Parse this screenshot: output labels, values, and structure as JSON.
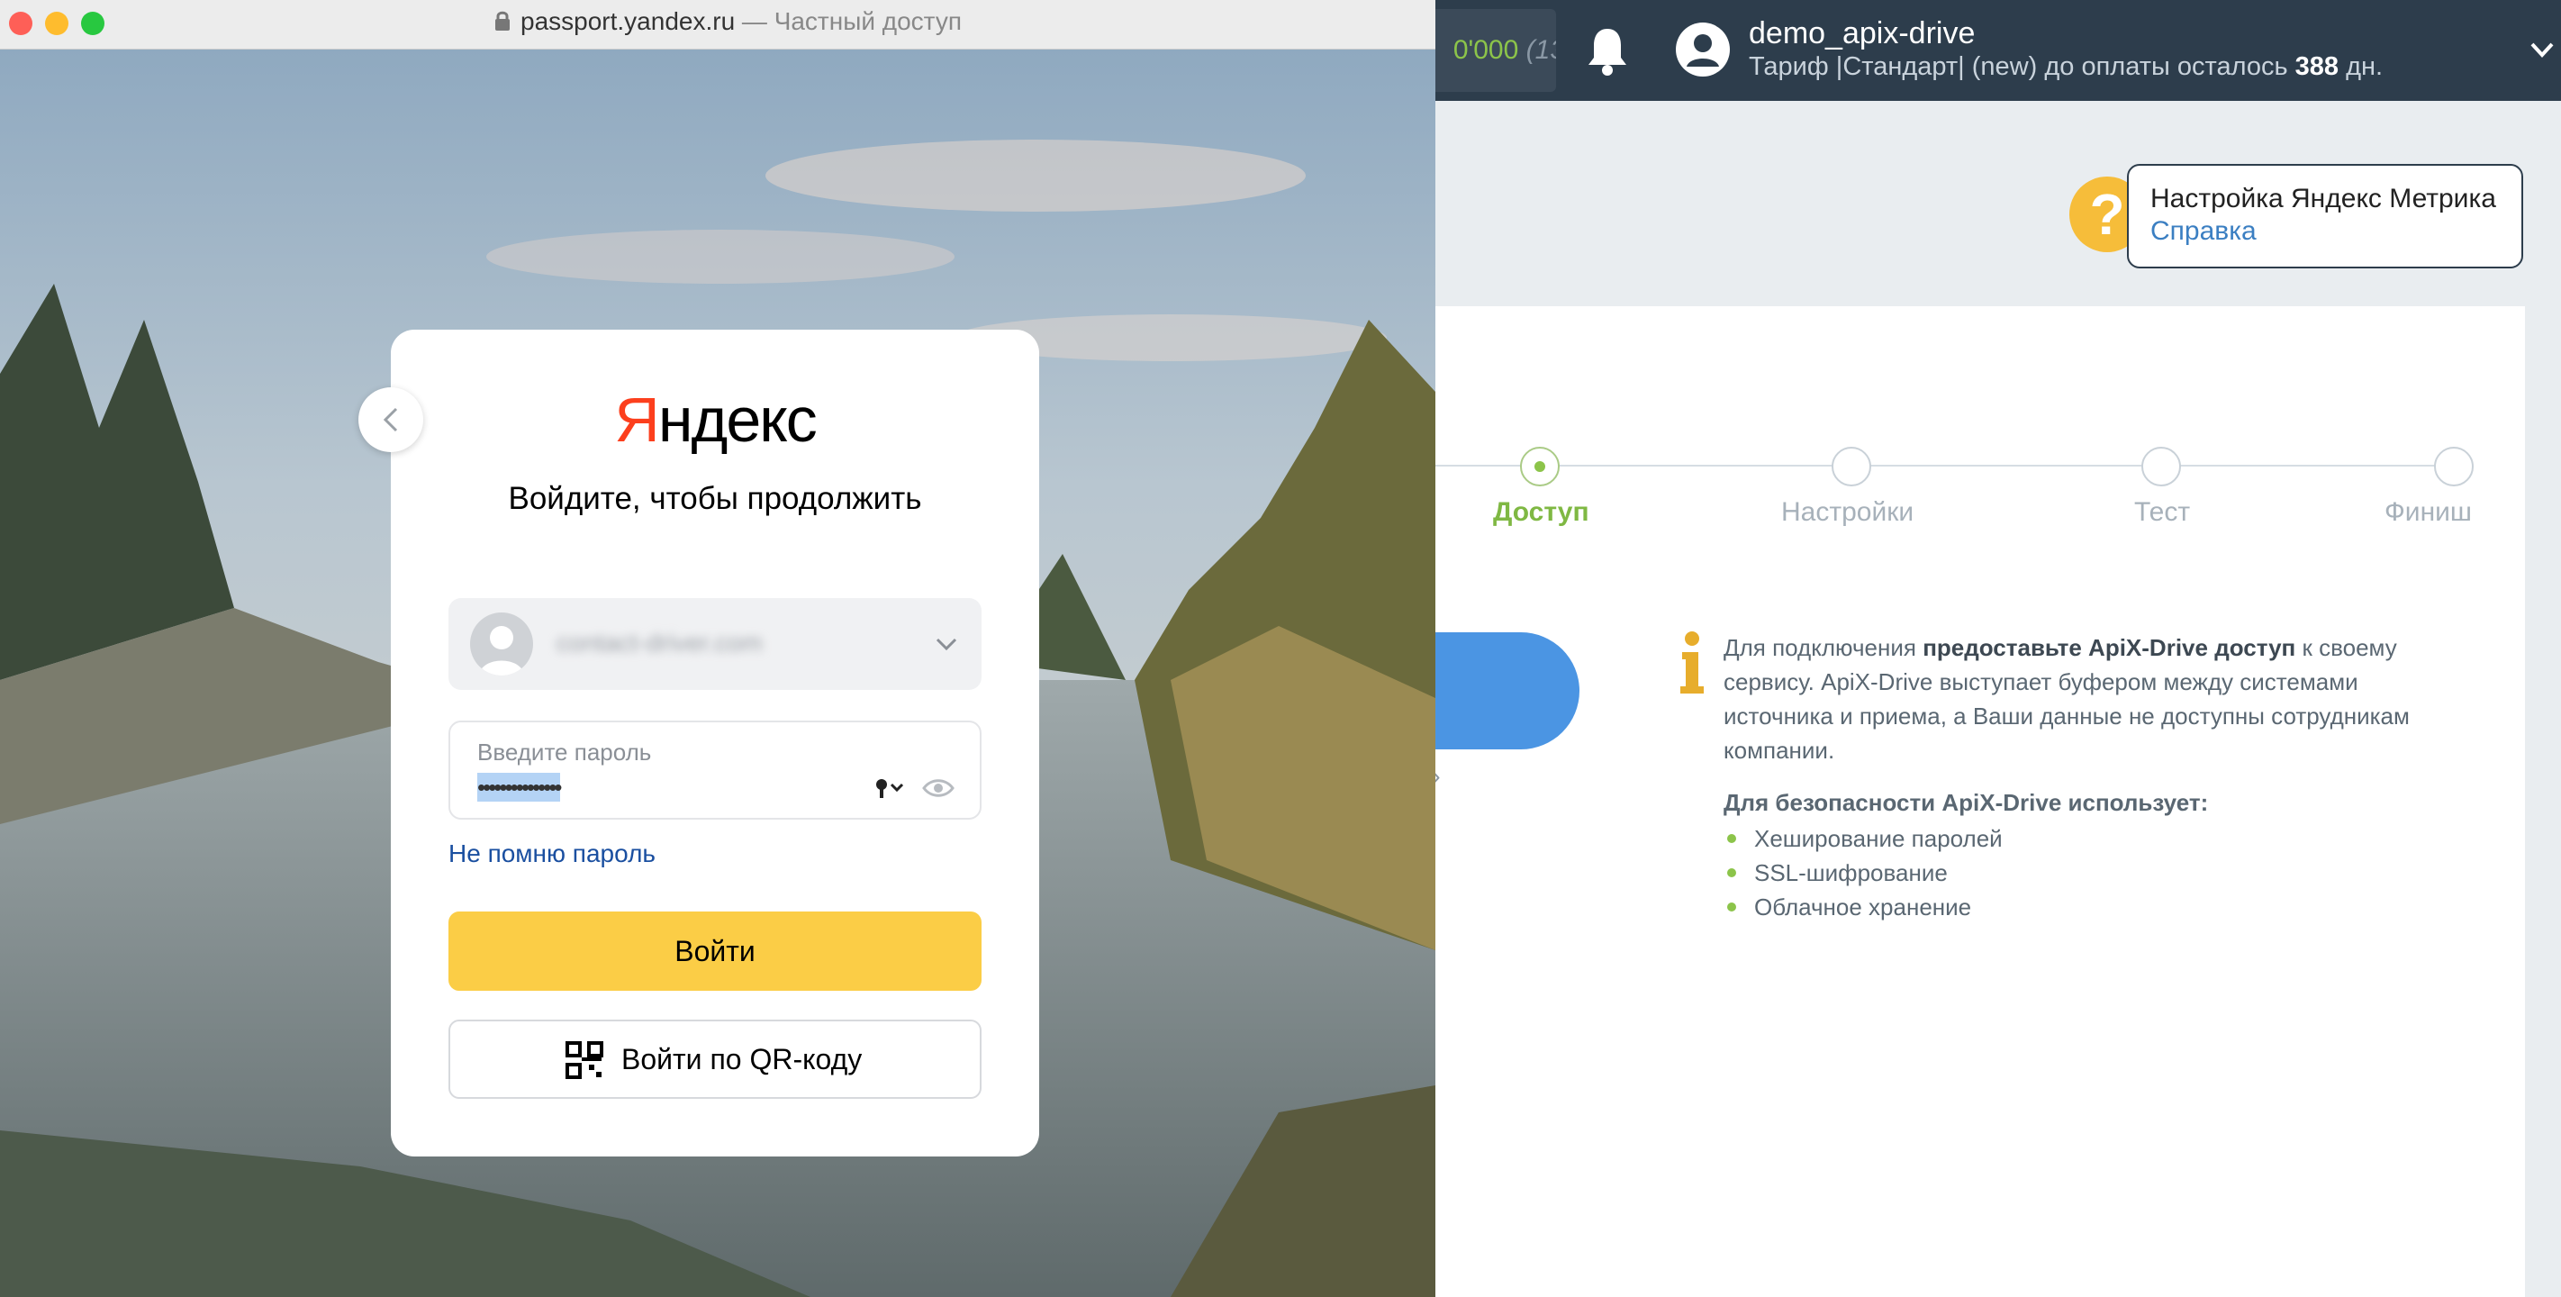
{
  "app": {
    "balance_text": "0'000",
    "balance_sub": "(13",
    "username": "demo_apix-drive",
    "tariff_prefix": "Тариф |Стандарт| (new) до оплаты осталось",
    "tariff_days": "388",
    "tariff_suffix": "дн.",
    "help_title": "Настройка Яндекс Метрика",
    "help_link": "Справка",
    "stray_paren": ")",
    "stray_quote": "»",
    "steps": [
      {
        "label": "Доступ",
        "state": "active"
      },
      {
        "label": "Настройки",
        "state": "inactive"
      },
      {
        "label": "Тест",
        "state": "inactive"
      },
      {
        "label": "Финиш",
        "state": "inactive"
      }
    ],
    "info_intro": "Для подключения",
    "info_bold": "предоставьте ApiX-Drive доступ",
    "info_rest": "к своему сервису. ApiX-Drive выступает буфером между системами источника и приема, а Ваши данные не доступны сотрудникам компании.",
    "security_title": "Для безопасности ApiX-Drive использует:",
    "security_items": [
      "Хеширование паролей",
      "SSL-шифрование",
      "Облачное хранение"
    ],
    "colors": {
      "header": "#2d3d4c",
      "accent_green": "#8cc44a",
      "primary_blue": "#4b95e3"
    }
  },
  "popup": {
    "url_host": "passport.yandex.ru",
    "url_suffix": "— Частный доступ"
  },
  "login": {
    "logo_y": "Я",
    "logo_rest": "ндекс",
    "title": "Войдите, чтобы продолжить",
    "account_email": "contact-driver.com",
    "password_label": "Введите пароль",
    "password_value": "•••••••••••••••",
    "forgot_link": "Не помню пароль",
    "login_button": "Войти",
    "qr_button": "Войти по QR-коду",
    "colors": {
      "logo_red": "#fc3f1d",
      "button_yellow": "#fbcd46",
      "link_blue": "#1a4fa0"
    }
  }
}
